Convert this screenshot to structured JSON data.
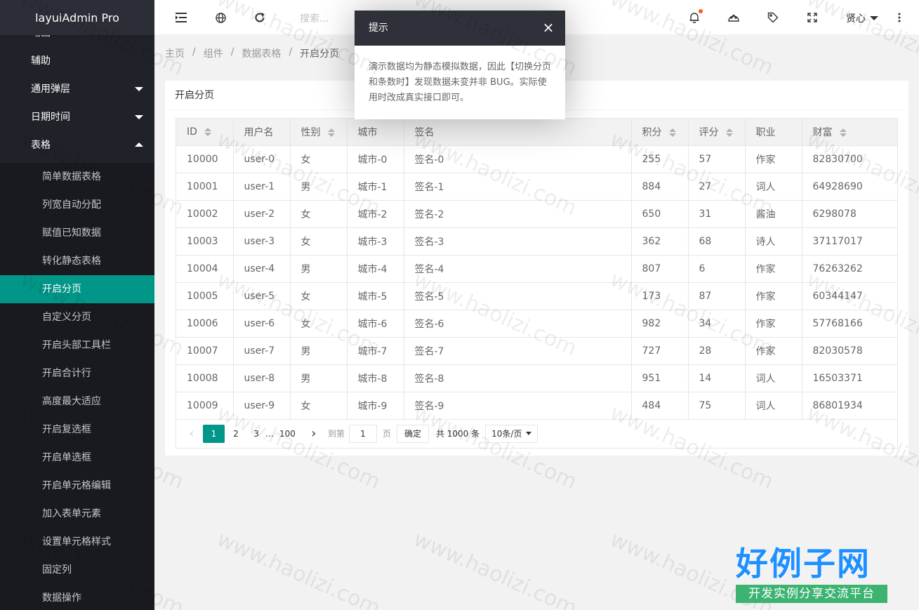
{
  "app": {
    "title": "layuiAdmin Pro"
  },
  "sidebar": {
    "partial_item": "动画",
    "items": [
      {
        "label": "辅助"
      },
      {
        "label": "通用弹层"
      },
      {
        "label": "日期时间"
      },
      {
        "label": "表格"
      }
    ],
    "sub_items": [
      {
        "label": "简单数据表格"
      },
      {
        "label": "列宽自动分配"
      },
      {
        "label": "赋值已知数据"
      },
      {
        "label": "转化静态表格"
      },
      {
        "label": "开启分页"
      },
      {
        "label": "自定义分页"
      },
      {
        "label": "开启头部工具栏"
      },
      {
        "label": "开启合计行"
      },
      {
        "label": "高度最大适应"
      },
      {
        "label": "开启复选框"
      },
      {
        "label": "开启单选框"
      },
      {
        "label": "开启单元格编辑"
      },
      {
        "label": "加入表单元素"
      },
      {
        "label": "设置单元格样式"
      },
      {
        "label": "固定列"
      },
      {
        "label": "数据操作"
      }
    ],
    "active_index": 4
  },
  "header": {
    "search_placeholder": "搜索...",
    "user_name": "贤心"
  },
  "icons": {
    "menu": "menu-fold-icon",
    "website": "globe-icon",
    "refresh": "refresh-icon",
    "notice": "bell-icon",
    "theme": "palette-icon",
    "note": "tag-icon",
    "fullscreen": "fullscreen-icon",
    "more": "more-vertical-icon"
  },
  "breadcrumb": [
    {
      "label": "主页"
    },
    {
      "label": "组件"
    },
    {
      "label": "数据表格"
    },
    {
      "label": "开启分页"
    }
  ],
  "breadcrumb_separator": "/",
  "card": {
    "title": "开启分页"
  },
  "table": {
    "columns": [
      {
        "label": "ID",
        "sortable": true
      },
      {
        "label": "用户名",
        "sortable": false
      },
      {
        "label": "性别",
        "sortable": true
      },
      {
        "label": "城市",
        "sortable": false
      },
      {
        "label": "签名",
        "sortable": false
      },
      {
        "label": "积分",
        "sortable": true
      },
      {
        "label": "评分",
        "sortable": true
      },
      {
        "label": "职业",
        "sortable": false
      },
      {
        "label": "财富",
        "sortable": true
      }
    ],
    "rows": [
      [
        "10000",
        "user-0",
        "女",
        "城市-0",
        "签名-0",
        "255",
        "57",
        "作家",
        "82830700"
      ],
      [
        "10001",
        "user-1",
        "男",
        "城市-1",
        "签名-1",
        "884",
        "27",
        "词人",
        "64928690"
      ],
      [
        "10002",
        "user-2",
        "女",
        "城市-2",
        "签名-2",
        "650",
        "31",
        "酱油",
        "6298078"
      ],
      [
        "10003",
        "user-3",
        "女",
        "城市-3",
        "签名-3",
        "362",
        "68",
        "诗人",
        "37117017"
      ],
      [
        "10004",
        "user-4",
        "男",
        "城市-4",
        "签名-4",
        "807",
        "6",
        "作家",
        "76263262"
      ],
      [
        "10005",
        "user-5",
        "女",
        "城市-5",
        "签名-5",
        "173",
        "87",
        "作家",
        "60344147"
      ],
      [
        "10006",
        "user-6",
        "女",
        "城市-6",
        "签名-6",
        "982",
        "34",
        "作家",
        "57768166"
      ],
      [
        "10007",
        "user-7",
        "男",
        "城市-7",
        "签名-7",
        "727",
        "28",
        "作家",
        "82030578"
      ],
      [
        "10008",
        "user-8",
        "男",
        "城市-8",
        "签名-8",
        "951",
        "14",
        "词人",
        "16503371"
      ],
      [
        "10009",
        "user-9",
        "女",
        "城市-9",
        "签名-9",
        "484",
        "75",
        "词人",
        "86801934"
      ]
    ]
  },
  "pager": {
    "prev": "‹",
    "next": "›",
    "pages": [
      "1",
      "2",
      "3"
    ],
    "ellipsis": "…",
    "last_page": "100",
    "current": "1",
    "goto_prefix": "到第",
    "goto_value": "1",
    "goto_suffix": "页",
    "confirm": "确定",
    "total": "共 1000 条",
    "page_size": "10条/页"
  },
  "dialog": {
    "title": "提示",
    "close": "×",
    "content": "演示数据均为静态模拟数据，因此【切换分页和条数时】发现数据未变并非 BUG。实际使用时改成真实接口即可。"
  },
  "watermark": {
    "text": "www.haolizi.com",
    "brand_big": "好例子网",
    "brand_small": "开发实例分享交流平台"
  }
}
